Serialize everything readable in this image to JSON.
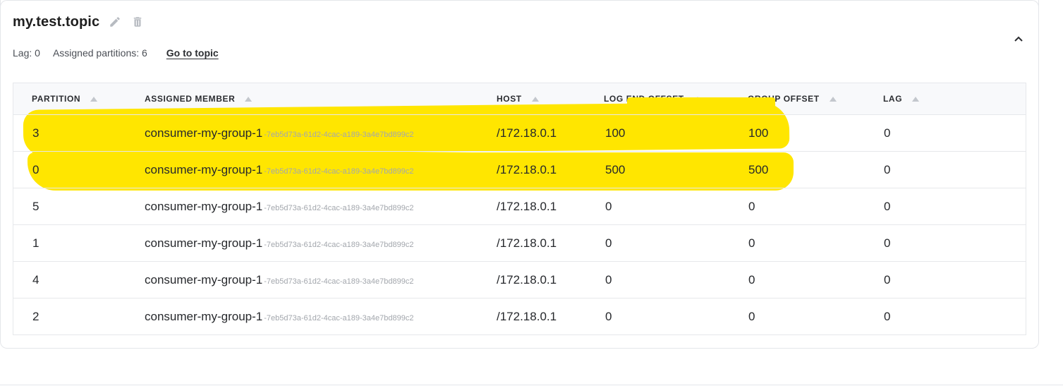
{
  "topic": {
    "name": "my.test.topic",
    "lag_label": "Lag: 0",
    "assigned_partitions_label": "Assigned partitions: 6",
    "go_to_topic_label": "Go to topic"
  },
  "icons": {
    "edit": "pencil-icon",
    "delete": "trash-icon",
    "collapse": "chevron-up-icon",
    "sort": "sort-up-icon"
  },
  "colors": {
    "highlight": "#ffe600",
    "header_bg": "#f8f9fb",
    "border": "#e6e8eb"
  },
  "table": {
    "columns": [
      "PARTITION",
      "ASSIGNED MEMBER",
      "HOST",
      "LOG END OFFSET",
      "GROUP OFFSET",
      "LAG"
    ],
    "rows": [
      {
        "partition": "3",
        "member": "consumer-my-group-1",
        "member_id": "-7eb5d73a-61d2-4cac-a189-3a4e7bd899c2",
        "host": "/172.18.0.1",
        "log_end_offset": "100",
        "group_offset": "100",
        "lag": "0"
      },
      {
        "partition": "0",
        "member": "consumer-my-group-1",
        "member_id": "-7eb5d73a-61d2-4cac-a189-3a4e7bd899c2",
        "host": "/172.18.0.1",
        "log_end_offset": "500",
        "group_offset": "500",
        "lag": "0"
      },
      {
        "partition": "5",
        "member": "consumer-my-group-1",
        "member_id": "-7eb5d73a-61d2-4cac-a189-3a4e7bd899c2",
        "host": "/172.18.0.1",
        "log_end_offset": "0",
        "group_offset": "0",
        "lag": "0"
      },
      {
        "partition": "1",
        "member": "consumer-my-group-1",
        "member_id": "-7eb5d73a-61d2-4cac-a189-3a4e7bd899c2",
        "host": "/172.18.0.1",
        "log_end_offset": "0",
        "group_offset": "0",
        "lag": "0"
      },
      {
        "partition": "4",
        "member": "consumer-my-group-1",
        "member_id": "-7eb5d73a-61d2-4cac-a189-3a4e7bd899c2",
        "host": "/172.18.0.1",
        "log_end_offset": "0",
        "group_offset": "0",
        "lag": "0"
      },
      {
        "partition": "2",
        "member": "consumer-my-group-1",
        "member_id": "-7eb5d73a-61d2-4cac-a189-3a4e7bd899c2",
        "host": "/172.18.0.1",
        "log_end_offset": "0",
        "group_offset": "0",
        "lag": "0"
      }
    ]
  }
}
